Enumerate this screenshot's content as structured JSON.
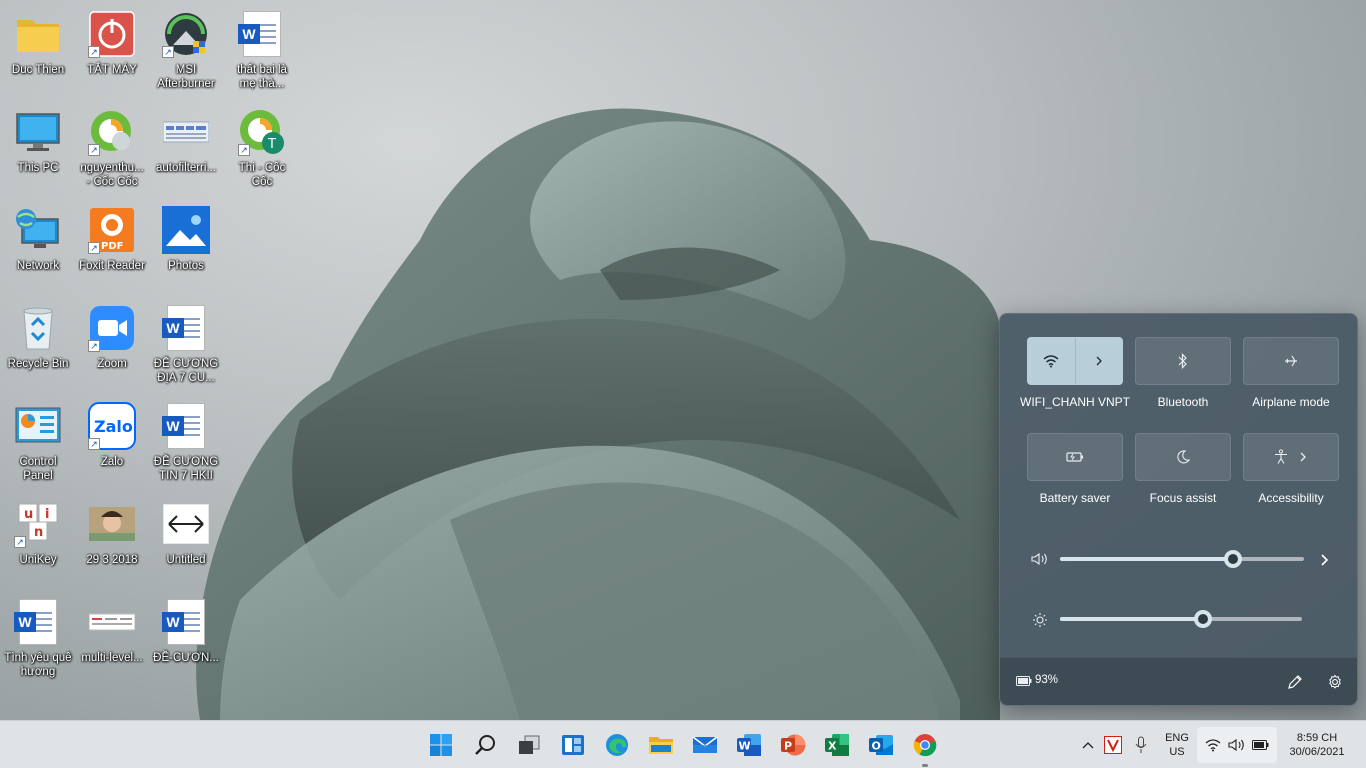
{
  "desktop": {
    "icons": [
      {
        "label": "Duc Thien"
      },
      {
        "label": "TẮT MÁY"
      },
      {
        "label": "MSI\nAfterburner"
      },
      {
        "label": "thất bại là\nmẹ thà..."
      },
      {
        "label": "This PC"
      },
      {
        "label": "nguyenthu...\n- Cốc Cốc"
      },
      {
        "label": "autofilterri..."
      },
      {
        "label": "Thi - Cốc\nCốc"
      },
      {
        "label": "Network"
      },
      {
        "label": "Foxit Reader"
      },
      {
        "label": "Photos"
      },
      {
        "label": "Recycle Bin"
      },
      {
        "label": "Zoom"
      },
      {
        "label": "ĐỀ CƯƠNG\nĐỊA 7 CU..."
      },
      {
        "label": "Control\nPanel"
      },
      {
        "label": "Zalo"
      },
      {
        "label": "ĐỀ CƯƠNG\nTIN 7 HKII"
      },
      {
        "label": "UniKey"
      },
      {
        "label": "29 3 2018"
      },
      {
        "label": "Untitled"
      },
      {
        "label": "Tình yêu quê\nhương"
      },
      {
        "label": "multi-level..."
      },
      {
        "label": "ĐỀ-CƯƠN..."
      }
    ],
    "badges": {
      "foxit": "PDF",
      "zalo": "Zalo",
      "cococ_t": "T",
      "word": "W",
      "unikey": [
        "u",
        "i",
        "n"
      ]
    }
  },
  "quick_settings": {
    "tiles": [
      {
        "label": "WIFI_CHANH\nVNPT",
        "icon": "wifi-icon",
        "active": true
      },
      {
        "label": "Bluetooth",
        "icon": "bluetooth-icon",
        "active": false
      },
      {
        "label": "Airplane mode",
        "icon": "airplane-icon",
        "active": false
      },
      {
        "label": "Battery saver",
        "icon": "battery-saver-icon",
        "active": false
      },
      {
        "label": "Focus assist",
        "icon": "moon-icon",
        "active": false
      },
      {
        "label": "Accessibility",
        "icon": "accessibility-icon",
        "active": false
      }
    ],
    "volume_level": 0.71,
    "brightness_level": 0.59,
    "battery_text": "93%"
  },
  "taskbar": {
    "pinned": [
      "start-icon",
      "search-icon",
      "task-view-icon",
      "widgets-icon",
      "edge-icon",
      "file-explorer-icon",
      "mail-icon",
      "word-icon",
      "powerpoint-icon",
      "excel-icon",
      "outlook-icon",
      "chrome-icon"
    ],
    "language_line1": "ENG",
    "language_line2": "US",
    "time": "8:59 CH",
    "date": "30/06/2021"
  },
  "colors": {
    "panel_bg": "#465662",
    "accent_tile": "#b8cfd9",
    "taskbar_bg": "#dfe3e6"
  }
}
